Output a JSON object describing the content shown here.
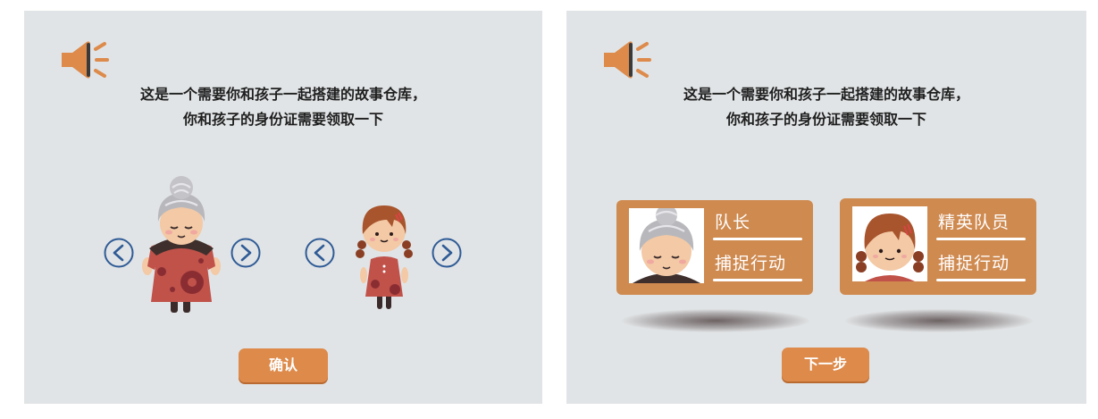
{
  "left_screen": {
    "prompt_line1": "这是一个需要你和孩子一起搭建的故事仓库，",
    "prompt_line2": "你和孩子的身份证需要领取一下",
    "speaker_icon": "speaker-icon",
    "adult_prev_icon": "chevron-left-icon",
    "adult_next_icon": "chevron-right-icon",
    "child_prev_icon": "chevron-left-icon",
    "child_next_icon": "chevron-right-icon",
    "confirm_label": "确认"
  },
  "right_screen": {
    "prompt_line1": "这是一个需要你和孩子一起搭建的故事仓库，",
    "prompt_line2": "你和孩子的身份证需要领取一下",
    "speaker_icon": "speaker-icon",
    "cards": [
      {
        "role": "队长",
        "mission": "捕捉行动"
      },
      {
        "role": "精英队员",
        "mission": "捕捉行动"
      }
    ],
    "next_label": "下一步"
  },
  "colors": {
    "background": "#e1e4e6",
    "accent": "#dd8a4b",
    "card": "#cf8a50",
    "arrow": "#2f5b96"
  }
}
